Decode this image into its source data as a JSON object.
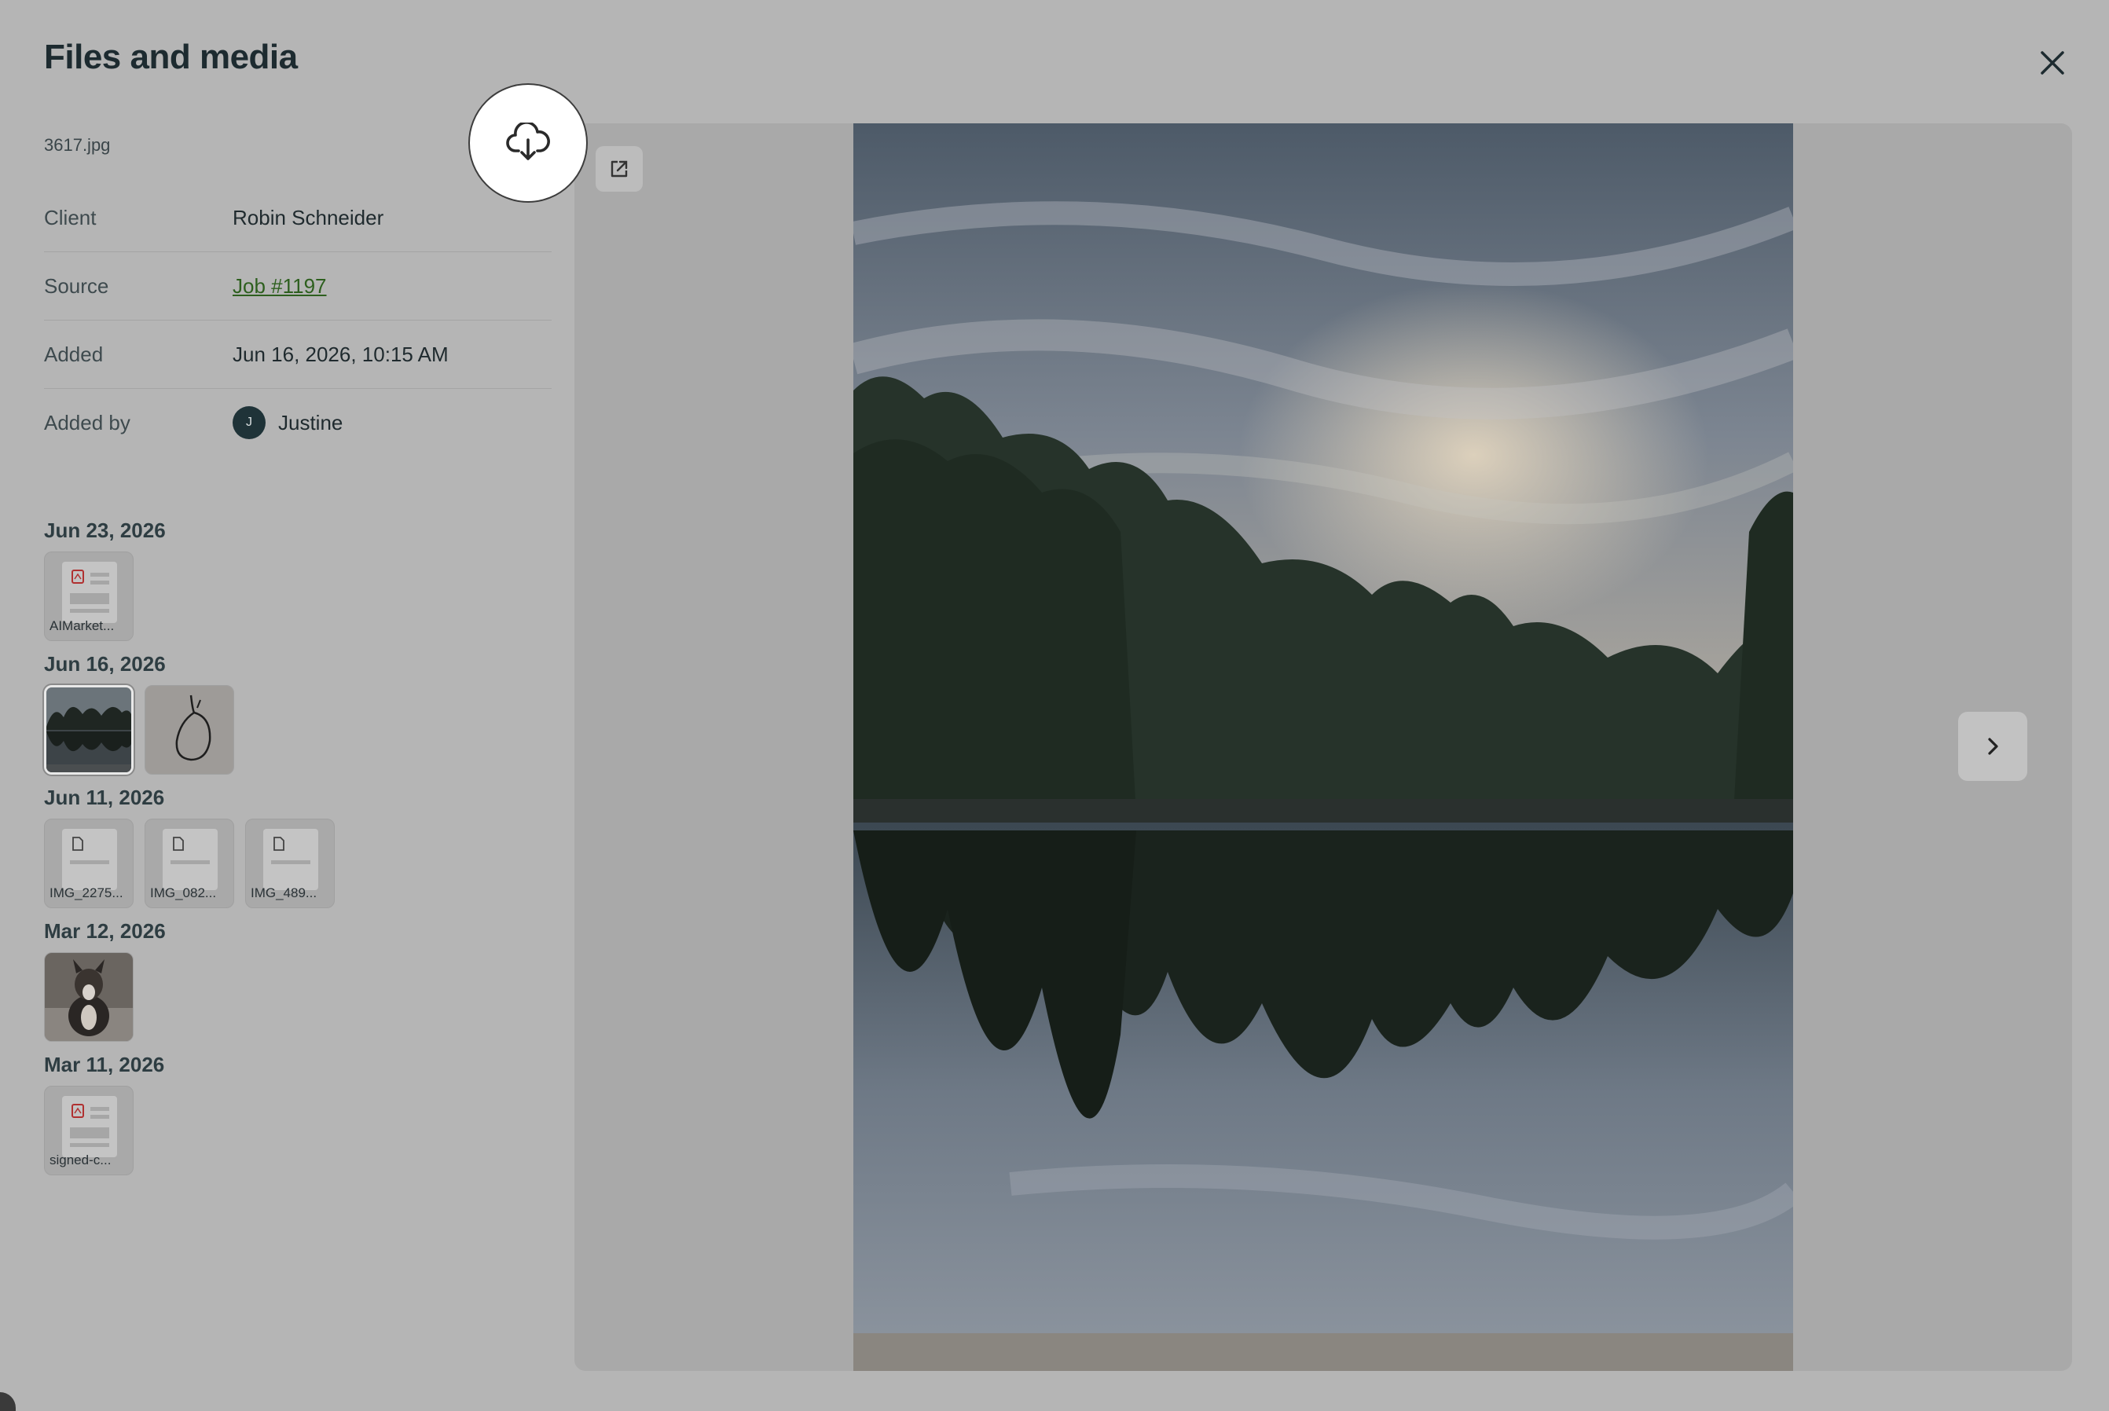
{
  "header": {
    "title": "Files and media"
  },
  "file": {
    "name": "3617.jpg"
  },
  "details": [
    {
      "label": "Client",
      "value": "Robin Schneider"
    },
    {
      "label": "Source",
      "value": "Job #1197"
    },
    {
      "label": "Added",
      "value": "Jun 16, 2026, 10:15 AM"
    },
    {
      "label": "Added by",
      "value": "Justine",
      "avatar_initial": "J"
    }
  ],
  "groups": [
    {
      "date": "Jun 23, 2026",
      "items": [
        {
          "kind": "pdf",
          "label": "AIMarket..."
        }
      ]
    },
    {
      "date": "Jun 16, 2026",
      "items": [
        {
          "kind": "image",
          "selected": true
        },
        {
          "kind": "image"
        }
      ]
    },
    {
      "date": "Jun 11, 2026",
      "items": [
        {
          "kind": "file",
          "label": "IMG_2275..."
        },
        {
          "kind": "file",
          "label": "IMG_082..."
        },
        {
          "kind": "file",
          "label": "IMG_489..."
        }
      ]
    },
    {
      "date": "Mar 12, 2026",
      "items": [
        {
          "kind": "image"
        }
      ]
    },
    {
      "date": "Mar 11, 2026",
      "items": [
        {
          "kind": "pdf",
          "label": "signed-c..."
        }
      ]
    }
  ],
  "icons": {
    "close": "close-icon",
    "download": "cloud-download-icon",
    "open": "open-external-icon",
    "next": "chevron-right-icon"
  },
  "colors": {
    "overlay": "#b5b5b5",
    "link": "#2d5f1e",
    "avatar": "#1f3338"
  }
}
